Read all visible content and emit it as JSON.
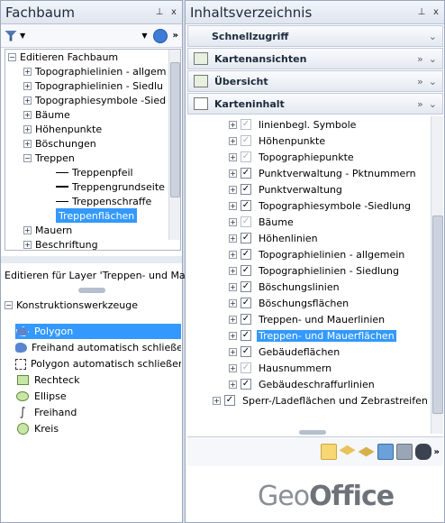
{
  "left_panel": {
    "title": "Fachbaum",
    "pin": "⊥",
    "close": "x",
    "tree": {
      "root": "Editieren Fachbaum",
      "items": [
        "Topographielinien - allgem",
        "Topographielinien - Siedlu",
        "Topographiesymbole -Sied",
        "Bäume",
        "Höhenpunkte",
        "Böschungen",
        "Treppen",
        "Treppenpfeil",
        "Treppengrundseite",
        "Treppenschraffe",
        "Treppenflächen",
        "Mauern",
        "Beschriftung"
      ]
    },
    "edit_label": "Editieren für Layer 'Treppen- und Ma...",
    "tools_header": "Konstruktionswerkzeuge",
    "tools": [
      "Polygon",
      "Freihand automatisch schließen",
      "Polygon automatisch schließen",
      "Rechteck",
      "Ellipse",
      "Freihand",
      "Kreis"
    ]
  },
  "right_panel": {
    "title": "Inhaltsverzeichnis",
    "pin": "⊥",
    "close": "x",
    "sections": {
      "quick": "Schnellzugriff",
      "maps": "Kartenansichten",
      "overview": "Übersicht",
      "content": "Karteninhalt"
    },
    "layers": [
      "linienbegl. Symbole",
      "Höhenpunkte",
      "Topographiepunkte",
      "Punktverwaltung - Pktnummern",
      "Punktverwaltung",
      "Topographiesymbole -Siedlung",
      "Bäume",
      "Höhenlinien",
      "Topographielinien - allgemein",
      "Topographielinien - Siedlung",
      "Böschungslinien",
      "Böschungsflächen",
      "Treppen- und Mauerlinien",
      "Treppen- und Mauerflächen",
      "Gebäudeflächen",
      "Hausnummern",
      "Gebäudeschraffurlinien"
    ],
    "top_group": "Sperr-/Ladeflächen und Zebrastreifen",
    "logo_a": "Geo",
    "logo_b": "Office"
  }
}
